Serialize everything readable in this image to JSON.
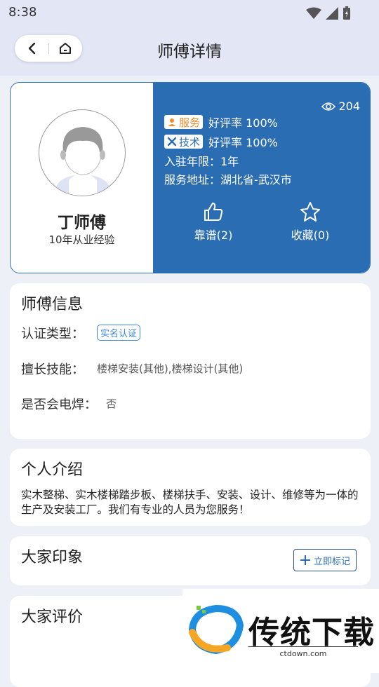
{
  "status": {
    "time": "8:38"
  },
  "header": {
    "title": "师傅详情"
  },
  "profile": {
    "name": "丁师傅",
    "experience": "10年从业经验",
    "views": "204",
    "service_tag": "服务",
    "service_rating": "好评率 100%",
    "tech_tag": "技术",
    "tech_rating": "好评率 100%",
    "years": "入驻年限：1年",
    "address": "服务地址：湖北省-武汉市",
    "like_label": "靠谱(2)",
    "favorite_label": "收藏(0)"
  },
  "master_info": {
    "title": "师傅信息",
    "cert_label": "认证类型：",
    "cert_value": "实名认证",
    "skills_label": "擅长技能：",
    "skills_value": "楼梯安装(其他),楼梯设计(其他)",
    "welding_label": "是否会电焊：",
    "welding_value": "否"
  },
  "intro": {
    "title": "个人介绍",
    "text": "实木整梯、实木楼梯踏步板、楼梯扶手、安装、设计、维修等为一体的生产及安装工厂。我们有专业的人员为您服务！"
  },
  "impression": {
    "title": "大家印象",
    "button": "立即标记"
  },
  "reviews": {
    "title": "大家评价"
  },
  "watermark": {
    "text": "传统下载",
    "url": "ctdown.com"
  },
  "colors": {
    "primary": "#2b6db3",
    "accent": "#f08a2b",
    "background": "#eef0f8"
  }
}
